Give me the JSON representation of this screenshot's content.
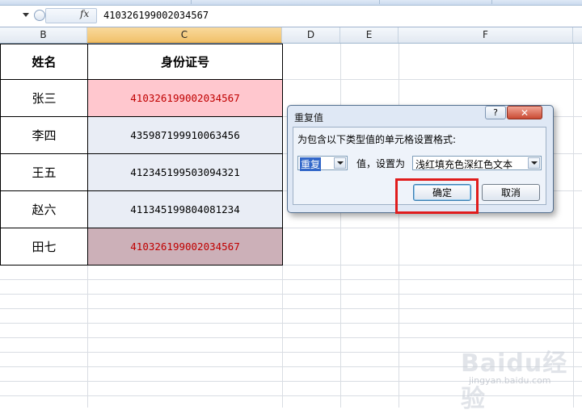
{
  "formula_bar": {
    "fx_label": "fx",
    "value": "410326199002034567"
  },
  "columns": [
    {
      "label": "B",
      "selected": false
    },
    {
      "label": "C",
      "selected": true
    },
    {
      "label": "D",
      "selected": false
    },
    {
      "label": "E",
      "selected": false
    },
    {
      "label": "F",
      "selected": false
    }
  ],
  "table": {
    "headers": [
      "姓名",
      "身份证号"
    ],
    "rows": [
      {
        "name": "张三",
        "id": "410326199002034567",
        "style": "dup-light"
      },
      {
        "name": "李四",
        "id": "435987199910063456",
        "style": "normal"
      },
      {
        "name": "王五",
        "id": "412345199503094321",
        "style": "normal"
      },
      {
        "name": "赵六",
        "id": "411345199804081234",
        "style": "normal"
      },
      {
        "name": "田七",
        "id": "410326199002034567",
        "style": "dup-dark"
      }
    ],
    "colors": {
      "dup-light": "#ffc7ce",
      "dup-dark": "#ccb0b8",
      "normal": "#e9edf5",
      "dup_text": "#c00000"
    }
  },
  "dialog": {
    "title": "重复值",
    "help_label": "?",
    "close_label": "✕",
    "instruction": "为包含以下类型值的单元格设置格式:",
    "type_select": "重复",
    "value_label": "值，设置为",
    "format_select": "浅红填充色深红色文本",
    "ok_label": "确定",
    "cancel_label": "取消"
  },
  "watermark": {
    "text": "Baidu经验",
    "sub": "jingyan.baidu.com"
  }
}
